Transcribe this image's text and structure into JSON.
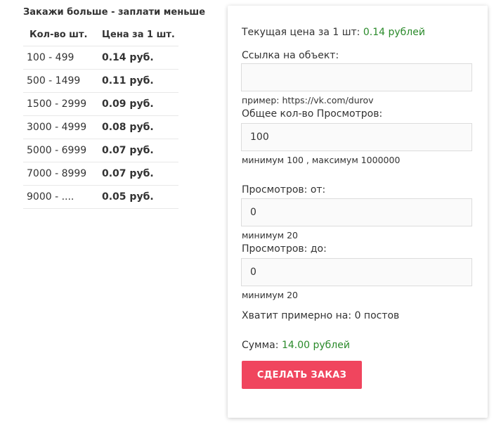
{
  "pricing": {
    "title": "Закажи больше - заплати меньше",
    "headers": {
      "qty": "Кол-во шт.",
      "price": "Цена за 1 шт."
    },
    "rows": [
      {
        "qty": "100 - 499",
        "price": "0.14 руб."
      },
      {
        "qty": "500 - 1499",
        "price": "0.11 руб."
      },
      {
        "qty": "1500 - 2999",
        "price": "0.09 руб."
      },
      {
        "qty": "3000 - 4999",
        "price": "0.08 руб."
      },
      {
        "qty": "5000 - 6999",
        "price": "0.07 руб."
      },
      {
        "qty": "7000 - 8999",
        "price": "0.07 руб."
      },
      {
        "qty": "9000 - ....",
        "price": "0.05 руб."
      }
    ]
  },
  "order": {
    "current_price_label": "Текущая цена за 1 шт:",
    "current_price_value": "0.14 рублей",
    "link_label": "Ссылка на объект:",
    "link_value": "",
    "link_placeholder": "",
    "link_hint": "пример: https://vk.com/durov",
    "views_label": "Общее кол-во Просмотров:",
    "views_value": "100",
    "views_hint": "минимум 100 , максимум 1000000",
    "from_label": "Просмотров: от:",
    "from_value": "0",
    "from_hint": "минимум 20",
    "to_label": "Просмотров: до:",
    "to_value": "0",
    "to_hint": "минимум 20",
    "enough_label": "Хватит примерно на:",
    "enough_value": "0 постов",
    "sum_label": "Сумма:",
    "sum_value": "14.00 рублей",
    "submit_label": "СДЕЛАТЬ ЗАКАЗ"
  },
  "colors": {
    "accent_green": "#2a8a2a",
    "button_red": "#f0455e"
  }
}
